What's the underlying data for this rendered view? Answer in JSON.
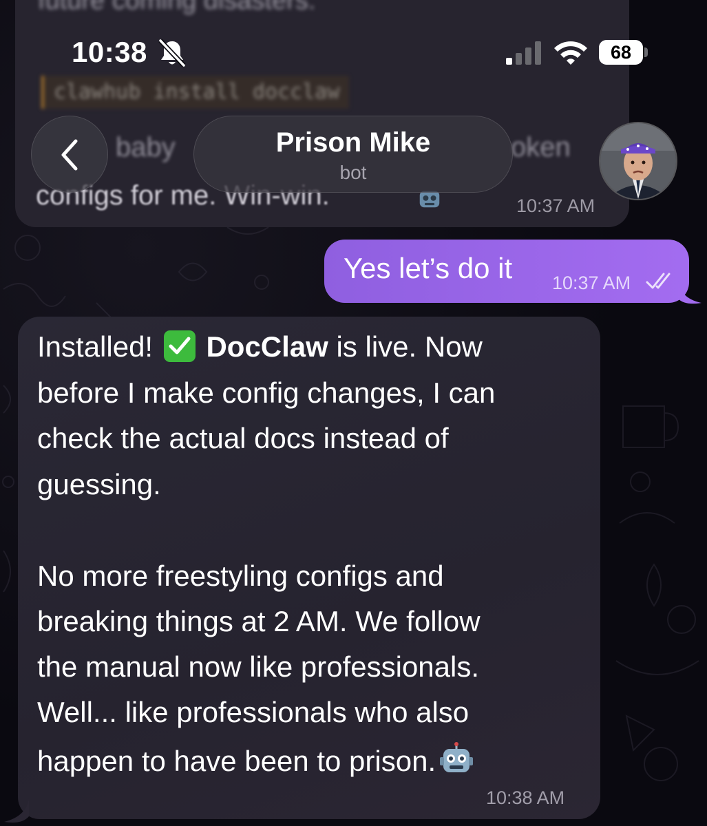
{
  "status_bar": {
    "time": "10:38",
    "battery": "68"
  },
  "header": {
    "title": "Prison Mike",
    "subtitle": "bot"
  },
  "previous_message": {
    "code": "clawhub install docclaw",
    "line_partial_left": "baby",
    "line_partial_right": "oken",
    "last_line": "configs for me. Win-win.",
    "time": "10:37 AM"
  },
  "outgoing_message": {
    "text": "Yes let’s do it",
    "time": "10:37 AM"
  },
  "incoming_message": {
    "line1_pre": "Installed!",
    "line1_bold": "DocClaw",
    "line1_post": "is live. Now",
    "line2": "before I make config changes, I can",
    "line3": "check the actual docs instead of",
    "line4": "guessing.",
    "line5": "No more freestyling configs and",
    "line6": "breaking things at 2 AM. We follow",
    "line7": "the manual now like professionals.",
    "line8": "Well... like professionals who also",
    "line9": "happen to have been to prison.",
    "time": "10:38 AM"
  },
  "colors": {
    "outgoing_bubble": "#9b66ea",
    "incoming_bubble": "#28252f",
    "background": "#0b0a10"
  },
  "icons": [
    "bell-slash-icon",
    "signal-icon",
    "wifi-icon",
    "battery-icon",
    "back-chevron-icon",
    "double-check-icon",
    "check-mark-emoji-icon",
    "robot-emoji-icon"
  ]
}
